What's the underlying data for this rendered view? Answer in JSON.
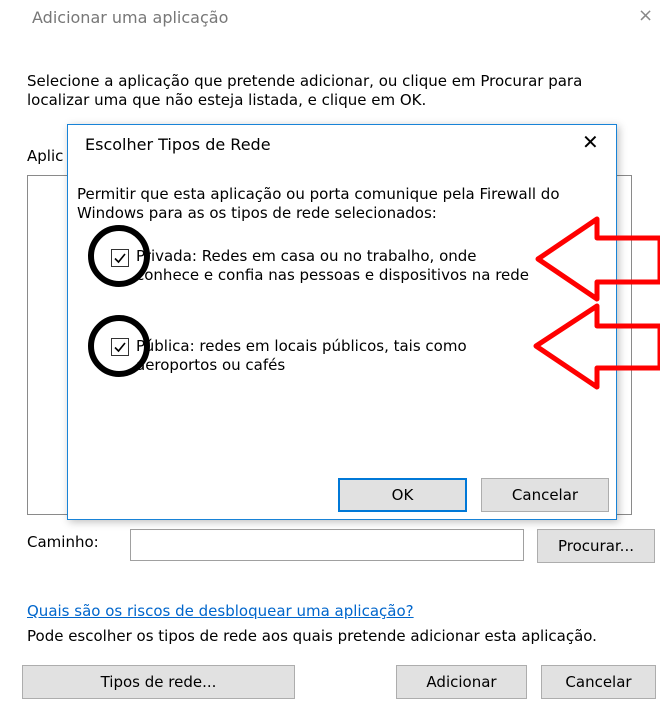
{
  "window": {
    "title": "Adicionar uma aplicação",
    "close_glyph": "×",
    "intro": "Selecione a aplicação que pretende adicionar, ou clique em Procurar para localizar uma que não esteja listada, e clique em OK.",
    "apps_label": "Aplic",
    "path_label": "Caminho:",
    "path_value": "",
    "browse_button": "Procurar...",
    "risk_link": "Quais são os riscos de desbloquear uma aplicação?",
    "footer_text": "Pode escolher os tipos de rede aos quais pretende adicionar esta aplicação.",
    "network_types_button": "Tipos de rede...",
    "add_button": "Adicionar",
    "cancel_button": "Cancelar"
  },
  "dialog": {
    "title": "Escolher Tipos de Rede",
    "close_glyph": "✕",
    "description": "Permitir que esta aplicação ou porta comunique pela Firewall do Windows para as os tipos de rede selecionados:",
    "options": [
      {
        "label": "Privada: Redes em casa ou no trabalho, onde conhece e confia nas pessoas e dispositivos na rede",
        "checked": true
      },
      {
        "label": "Pública: redes em locais públicos, tais como aeroportos ou cafés",
        "checked": true
      }
    ],
    "ok_button": "OK",
    "cancel_button": "Cancelar"
  },
  "colors": {
    "accent_border": "#1883d7",
    "link": "#0066cc",
    "annotation_arrow": "#ff0000",
    "annotation_circle": "#000000"
  }
}
